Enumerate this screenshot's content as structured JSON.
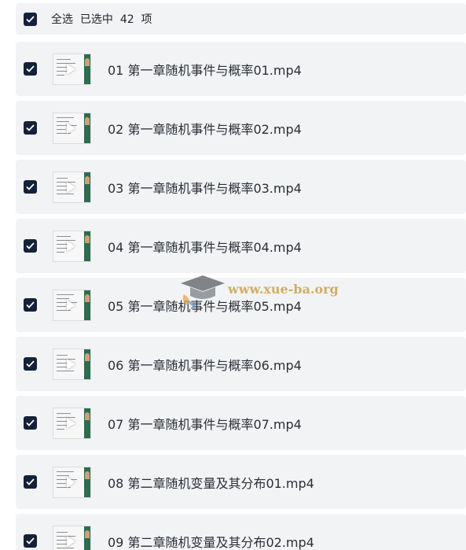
{
  "header": {
    "select_all_label": "全选",
    "selected_prefix": "已选中",
    "selected_count": "42",
    "selected_suffix": "项",
    "checked": true
  },
  "files": [
    {
      "name": "01 第一章随机事件与概率01.mp4",
      "checked": true
    },
    {
      "name": "02 第一章随机事件与概率02.mp4",
      "checked": true
    },
    {
      "name": "03 第一章随机事件与概率03.mp4",
      "checked": true
    },
    {
      "name": "04 第一章随机事件与概率04.mp4",
      "checked": true
    },
    {
      "name": "05 第一章随机事件与概率05.mp4",
      "checked": true
    },
    {
      "name": "06 第一章随机事件与概率06.mp4",
      "checked": true
    },
    {
      "name": "07 第一章随机事件与概率07.mp4",
      "checked": true
    },
    {
      "name": "08 第二章随机变量及其分布01.mp4",
      "checked": true
    },
    {
      "name": "09 第二章随机变量及其分布02.mp4",
      "checked": true
    }
  ],
  "watermark": {
    "text": "www.xue-ba.org",
    "icon": "graduation-cap-icon"
  },
  "colors": {
    "checkbox": "#14213a",
    "row_background": "#f2f3f5",
    "watermark_text": "#c9a34a"
  }
}
